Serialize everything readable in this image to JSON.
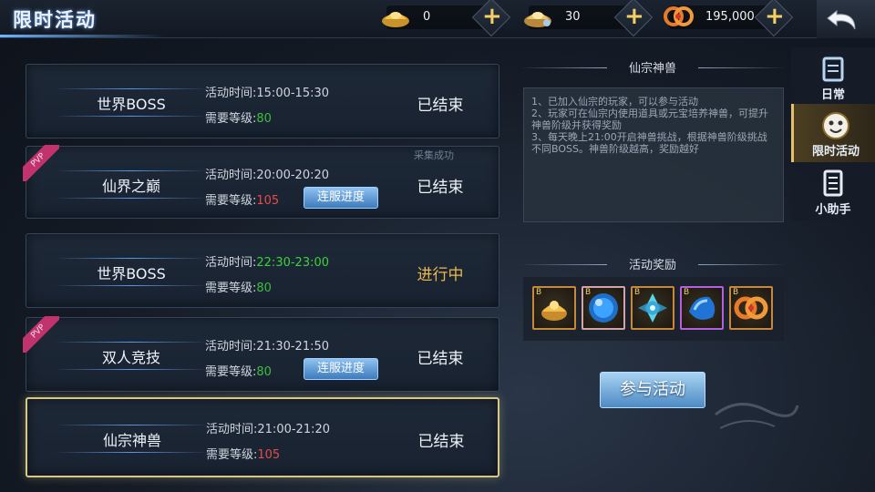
{
  "header": {
    "title": "限时活动"
  },
  "currencies": [
    {
      "icon": "gold-ingot-icon",
      "value": "0"
    },
    {
      "icon": "silver-ingot-icon",
      "value": "30"
    },
    {
      "icon": "copper-coin-icon",
      "value": "195,000"
    }
  ],
  "activities": [
    {
      "name": "世界BOSS",
      "time_label": "活动时间:",
      "time": "15:00-15:30",
      "time_color": "normal",
      "level_label": "需要等级:",
      "level": "80",
      "level_color": "green",
      "status": "已结束",
      "status_active": false,
      "pvp": false,
      "server_button": ""
    },
    {
      "name": "仙界之巅",
      "time_label": "活动时间:",
      "time": "20:00-20:20",
      "time_color": "normal",
      "level_label": "需要等级:",
      "level": "105",
      "level_color": "red",
      "status": "已结束",
      "status_active": false,
      "pvp": true,
      "pvp_label": "PVP",
      "server_button": "连服进度"
    },
    {
      "name": "世界BOSS",
      "time_label": "活动时间:",
      "time": "22:30-23:00",
      "time_color": "green",
      "level_label": "需要等级:",
      "level": "80",
      "level_color": "green",
      "status": "进行中",
      "status_active": true,
      "pvp": false,
      "server_button": ""
    },
    {
      "name": "双人竞技",
      "time_label": "活动时间:",
      "time": "21:30-21:50",
      "time_color": "normal",
      "level_label": "需要等级:",
      "level": "80",
      "level_color": "green",
      "status": "已结束",
      "status_active": false,
      "pvp": true,
      "pvp_label": "PVP",
      "server_button": "连服进度"
    },
    {
      "name": "仙宗神兽",
      "time_label": "活动时间:",
      "time": "21:00-21:20",
      "time_color": "normal",
      "level_label": "需要等级:",
      "level": "105",
      "level_color": "red",
      "status": "已结束",
      "status_active": false,
      "pvp": false,
      "server_button": "",
      "selected": true
    }
  ],
  "collect_label": "采集成功",
  "detail": {
    "title": "仙宗神兽",
    "description": [
      "1、已加入仙宗的玩家，可以参与活动",
      "2、玩家可在仙宗内使用道具或元宝培养神兽，可提升神兽阶级并获得奖励",
      "3、每天晚上21:00开启神兽挑战，根据神兽阶级挑战不同BOSS。神兽阶级越高，奖励越好"
    ],
    "reward_title": "活动奖励",
    "rewards": [
      {
        "icon": "gold-ingot-bag-icon",
        "border": "orange"
      },
      {
        "icon": "blue-orb-icon",
        "border": "orange"
      },
      {
        "icon": "crystal-cluster-icon",
        "border": "orange"
      },
      {
        "icon": "blue-gem-icon",
        "border": "purple"
      },
      {
        "icon": "copper-coin-icon",
        "border": "orange"
      }
    ],
    "join_button": "参与活动"
  },
  "side_tabs": [
    {
      "label": "日常",
      "icon": "daily-icon",
      "active": false
    },
    {
      "label": "限时活动",
      "icon": "limited-activity-icon",
      "active": true
    },
    {
      "label": "小助手",
      "icon": "assistant-icon",
      "active": false
    }
  ]
}
